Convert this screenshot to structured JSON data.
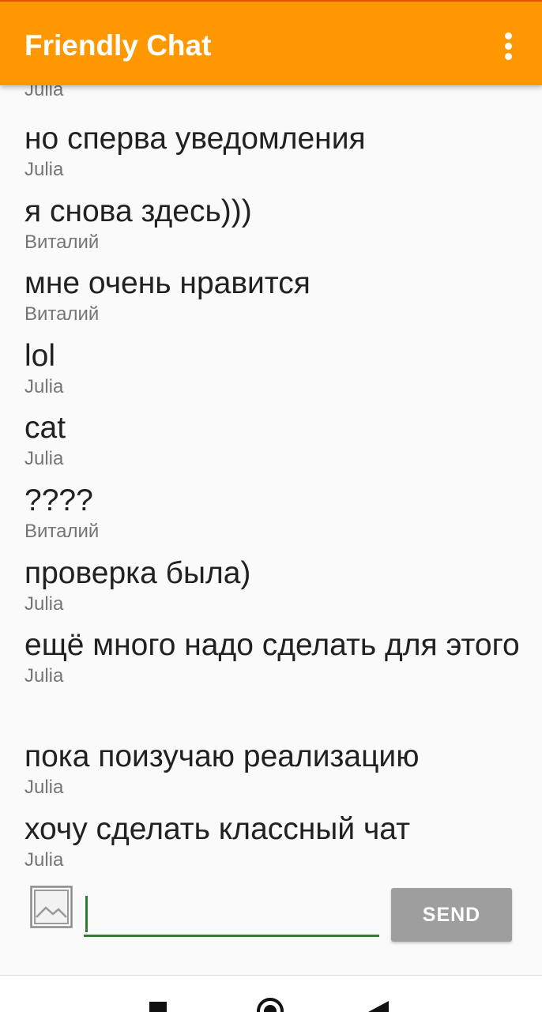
{
  "app_bar": {
    "title": "Friendly Chat",
    "overflow_icon": "more-vert-icon",
    "background_color": "#ff9800",
    "title_color": "#ffffff"
  },
  "messages": [
    {
      "text": "но сперва уведомления",
      "name": "Julia"
    },
    {
      "text": "я снова здесь)))",
      "name": "Виталий"
    },
    {
      "text": "мне очень нравится",
      "name": "Виталий"
    },
    {
      "text": "lol",
      "name": "Julia"
    },
    {
      "text": "cat",
      "name": "Julia"
    },
    {
      "text": "????",
      "name": "Виталий"
    },
    {
      "text": "проверка была)",
      "name": "Julia"
    },
    {
      "text": "ещё много надо сделать для этого",
      "name": "Julia"
    },
    {
      "text": "пока поизучаю реализацию",
      "name": "Julia"
    },
    {
      "text": "хочу сделать классный чат",
      "name": "Julia"
    }
  ],
  "cutoff_top_name": "Julia",
  "composer": {
    "add_image_icon": "image-icon",
    "input_value": "",
    "send_label": "SEND",
    "send_button_color": "#9e9e9e",
    "underline_color": "#2e7d32"
  },
  "system_nav": {
    "recents_icon": "square-icon",
    "home_icon": "circle-icon",
    "back_icon": "triangle-back-icon"
  }
}
